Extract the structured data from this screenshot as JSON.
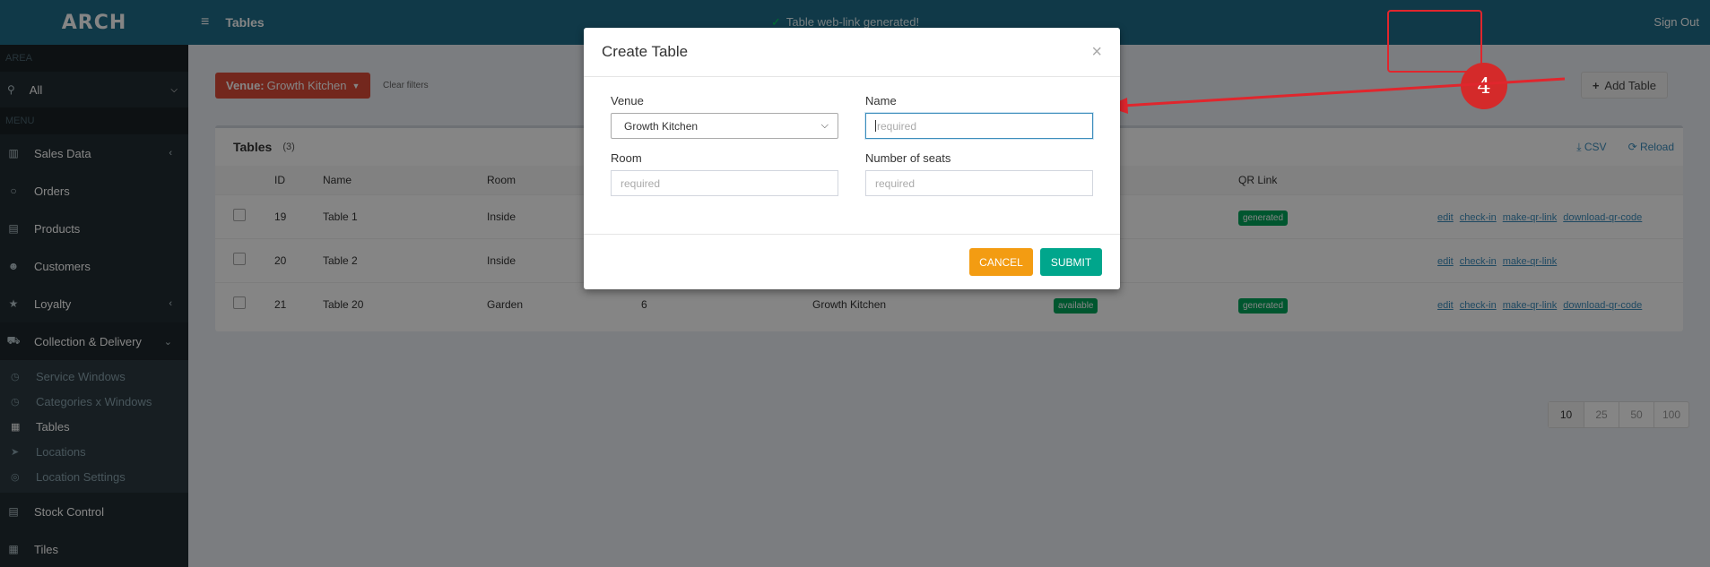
{
  "app": {
    "logo_text": "ARCH",
    "page_title": "Tables",
    "notification": "Table web-link generated!",
    "sign_out": "Sign Out"
  },
  "sidebar": {
    "area_header": "AREA",
    "area_select": "All",
    "menu_header": "MENU",
    "items": [
      {
        "label": "Sales Data",
        "icon": "bar-chart-icon",
        "chevron": "‹"
      },
      {
        "label": "Orders",
        "icon": "circle-icon",
        "chevron": ""
      },
      {
        "label": "Products",
        "icon": "list-icon",
        "chevron": ""
      },
      {
        "label": "Customers",
        "icon": "users-icon",
        "chevron": ""
      },
      {
        "label": "Loyalty",
        "icon": "star-icon",
        "chevron": "‹"
      },
      {
        "label": "Collection & Delivery",
        "icon": "truck-icon",
        "chevron": "⌄"
      }
    ],
    "subitems": [
      {
        "label": "Service Windows",
        "icon": "clock-icon"
      },
      {
        "label": "Categories x Windows",
        "icon": "clock-icon"
      },
      {
        "label": "Tables",
        "icon": "grid-icon"
      },
      {
        "label": "Locations",
        "icon": "location-arrow-icon"
      },
      {
        "label": "Location Settings",
        "icon": "compass-icon"
      }
    ],
    "bottom_items": [
      {
        "label": "Stock Control",
        "icon": "list-icon"
      },
      {
        "label": "Tiles",
        "icon": "grid-icon"
      }
    ]
  },
  "filters": {
    "venue_prefix": "Venue:",
    "venue_value": "Growth Kitchen",
    "clear": "Clear filters"
  },
  "add_table": "Add Table",
  "annotation_number": "4",
  "table_box": {
    "title": "Tables",
    "count": "(3)",
    "csv": "CSV",
    "reload": "Reload",
    "columns": {
      "id": "ID",
      "name": "Name",
      "room": "Room",
      "qr": "QR Link"
    },
    "rows": [
      {
        "id": "19",
        "name": "Table 1",
        "room": "Inside",
        "seats": "",
        "venue": "",
        "status": "",
        "qr": "generated",
        "actions": [
          "edit",
          "check-in",
          "make-qr-link",
          "download-qr-code"
        ]
      },
      {
        "id": "20",
        "name": "Table 2",
        "room": "Inside",
        "seats": "",
        "venue": "",
        "status": "",
        "qr": "",
        "actions": [
          "edit",
          "check-in",
          "make-qr-link"
        ]
      },
      {
        "id": "21",
        "name": "Table 20",
        "room": "Garden",
        "seats": "6",
        "venue": "Growth Kitchen",
        "status": "available",
        "qr": "generated",
        "actions": [
          "edit",
          "check-in",
          "make-qr-link",
          "download-qr-code"
        ]
      }
    ]
  },
  "pager": [
    "10",
    "25",
    "50",
    "100"
  ],
  "modal": {
    "title": "Create Table",
    "close": "×",
    "venue_label": "Venue",
    "venue_value": "Growth Kitchen",
    "name_label": "Name",
    "name_placeholder": "required",
    "room_label": "Room",
    "room_placeholder": "required",
    "seats_label": "Number of seats",
    "seats_placeholder": "required",
    "cancel": "CANCEL",
    "submit": "SUBMIT"
  },
  "colors": {
    "topbar": "#1f6e8a",
    "sidebar": "#222d32",
    "venue_button": "#dd4b39",
    "cancel": "#f39c12",
    "submit": "#00a68c",
    "annotation": "#e0262d"
  }
}
